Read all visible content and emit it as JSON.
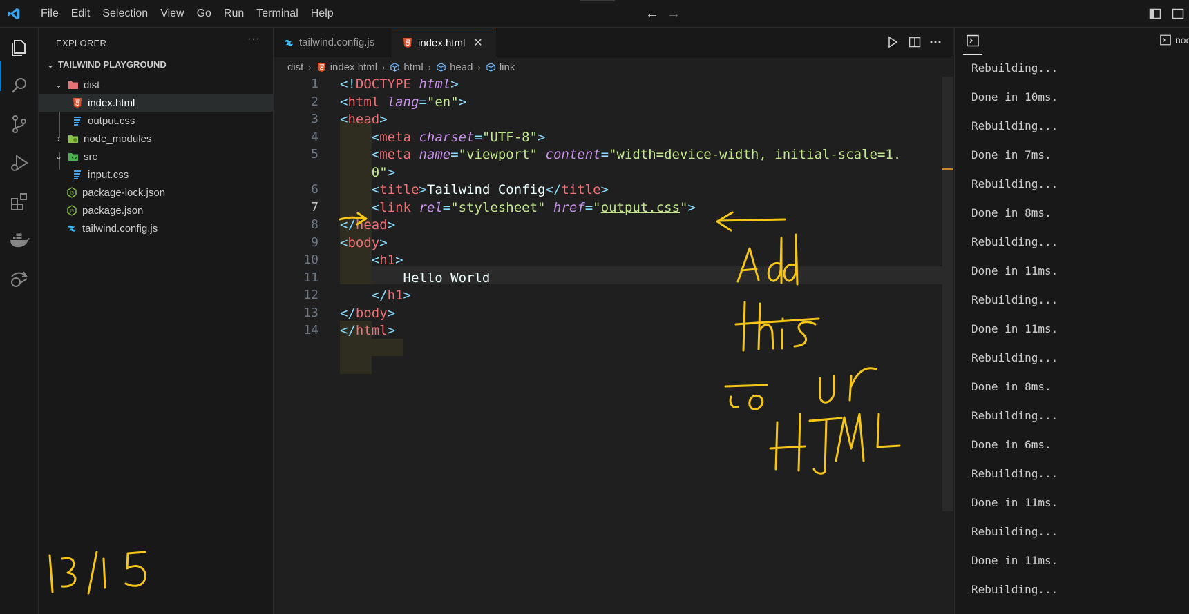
{
  "menu": [
    "File",
    "Edit",
    "Selection",
    "View",
    "Go",
    "Run",
    "Terminal",
    "Help"
  ],
  "sidebar": {
    "title": "EXPLORER",
    "more": "···",
    "project": "TAILWIND PLAYGROUND",
    "tree": [
      {
        "label": "dist",
        "type": "folder",
        "expanded": true,
        "icon": "dist-folder-icon"
      },
      {
        "label": "index.html",
        "type": "file",
        "icon": "html5-icon",
        "selected": true
      },
      {
        "label": "output.css",
        "type": "file",
        "icon": "css-icon"
      },
      {
        "label": "node_modules",
        "type": "folder",
        "expanded": false,
        "icon": "node-folder-icon"
      },
      {
        "label": "src",
        "type": "folder",
        "expanded": true,
        "icon": "src-folder-icon"
      },
      {
        "label": "input.css",
        "type": "file",
        "icon": "css-icon"
      },
      {
        "label": "package-lock.json",
        "type": "file",
        "icon": "nodejs-icon"
      },
      {
        "label": "package.json",
        "type": "file",
        "icon": "nodejs-icon"
      },
      {
        "label": "tailwind.config.js",
        "type": "file",
        "icon": "tailwind-icon"
      }
    ]
  },
  "tabs": [
    {
      "label": "tailwind.config.js",
      "active": false
    },
    {
      "label": "index.html",
      "active": true,
      "close": "✕"
    }
  ],
  "breadcrumb": [
    "dist",
    "index.html",
    "html",
    "head",
    "link"
  ],
  "code": {
    "current_line": 7,
    "lines": [
      {
        "n": "1",
        "tokens": [
          [
            "br",
            "<!"
          ],
          [
            "tag",
            "DOCTYPE"
          ],
          [
            "txt",
            " "
          ],
          [
            "attr",
            "html"
          ],
          [
            "br",
            ">"
          ]
        ]
      },
      {
        "n": "2",
        "tokens": [
          [
            "br",
            "<"
          ],
          [
            "tag",
            "html"
          ],
          [
            "txt",
            " "
          ],
          [
            "attr",
            "lang"
          ],
          [
            "br",
            "="
          ],
          [
            "str",
            "\"en\""
          ],
          [
            "br",
            ">"
          ]
        ]
      },
      {
        "n": "3",
        "tokens": [
          [
            "br",
            "<"
          ],
          [
            "tag",
            "head"
          ],
          [
            "br",
            ">"
          ]
        ]
      },
      {
        "n": "4",
        "tokens": [
          [
            "txt",
            "    "
          ],
          [
            "br",
            "<"
          ],
          [
            "tag",
            "meta"
          ],
          [
            "txt",
            " "
          ],
          [
            "attr",
            "charset"
          ],
          [
            "br",
            "="
          ],
          [
            "str",
            "\"UTF-8\""
          ],
          [
            "br",
            ">"
          ]
        ]
      },
      {
        "n": "5",
        "tokens": [
          [
            "txt",
            "    "
          ],
          [
            "br",
            "<"
          ],
          [
            "tag",
            "meta"
          ],
          [
            "txt",
            " "
          ],
          [
            "attr",
            "name"
          ],
          [
            "br",
            "="
          ],
          [
            "str",
            "\"viewport\""
          ],
          [
            "txt",
            " "
          ],
          [
            "attr",
            "content"
          ],
          [
            "br",
            "="
          ],
          [
            "str",
            "\"width=device-width, initial-scale=1."
          ]
        ]
      },
      {
        "n": "",
        "tokens": [
          [
            "txt",
            "    "
          ],
          [
            "str",
            "0\""
          ],
          [
            "br",
            ">"
          ]
        ]
      },
      {
        "n": "6",
        "tokens": [
          [
            "txt",
            "    "
          ],
          [
            "br",
            "<"
          ],
          [
            "tag",
            "title"
          ],
          [
            "br",
            ">"
          ],
          [
            "txt",
            "Tailwind Config"
          ],
          [
            "br",
            "</"
          ],
          [
            "tag",
            "title"
          ],
          [
            "br",
            ">"
          ]
        ]
      },
      {
        "n": "7",
        "tokens": [
          [
            "txt",
            "    "
          ],
          [
            "br",
            "<"
          ],
          [
            "tag",
            "link"
          ],
          [
            "txt",
            " "
          ],
          [
            "attr",
            "rel"
          ],
          [
            "br",
            "="
          ],
          [
            "str",
            "\"stylesheet\""
          ],
          [
            "txt",
            " "
          ],
          [
            "attr",
            "href"
          ],
          [
            "br",
            "="
          ],
          [
            "str",
            "\""
          ],
          [
            "str",
            "output.css"
          ],
          [
            "str",
            "\""
          ],
          [
            "br",
            ">"
          ]
        ]
      },
      {
        "n": "8",
        "tokens": [
          [
            "br",
            "</"
          ],
          [
            "tag",
            "head"
          ],
          [
            "br",
            ">"
          ]
        ]
      },
      {
        "n": "9",
        "tokens": [
          [
            "br",
            "<"
          ],
          [
            "tag",
            "body"
          ],
          [
            "br",
            ">"
          ]
        ]
      },
      {
        "n": "10",
        "tokens": [
          [
            "txt",
            "    "
          ],
          [
            "br",
            "<"
          ],
          [
            "tag",
            "h1"
          ],
          [
            "br",
            ">"
          ]
        ]
      },
      {
        "n": "11",
        "tokens": [
          [
            "txt",
            "        Hello World"
          ]
        ]
      },
      {
        "n": "12",
        "tokens": [
          [
            "txt",
            "    "
          ],
          [
            "br",
            "</"
          ],
          [
            "tag",
            "h1"
          ],
          [
            "br",
            ">"
          ]
        ]
      },
      {
        "n": "13",
        "tokens": [
          [
            "br",
            "</"
          ],
          [
            "tag",
            "body"
          ],
          [
            "br",
            ">"
          ]
        ]
      },
      {
        "n": "14",
        "tokens": [
          [
            "br",
            "</"
          ],
          [
            "tag",
            "html"
          ],
          [
            "br",
            ">"
          ]
        ]
      }
    ]
  },
  "terminal": {
    "tab2_label": "nod",
    "lines": [
      "Rebuilding...",
      "Done in 10ms.",
      "Rebuilding...",
      "Done in 7ms.",
      "Rebuilding...",
      "Done in 8ms.",
      "Rebuilding...",
      "Done in 11ms.",
      "Rebuilding...",
      "Done in 11ms.",
      "Rebuilding...",
      "Done in 8ms.",
      "Rebuilding...",
      "Done in 6ms.",
      "Rebuilding...",
      "Done in 11ms.",
      "Rebuilding...",
      "Done in 11ms.",
      "Rebuilding..."
    ]
  },
  "annotations": {
    "note": "Add this to ur HTML",
    "counter": "13/15",
    "color": "#f5c518"
  },
  "colors": {
    "accent": "#0078d4",
    "html_icon": "#e44d26",
    "css_icon": "#42a5f5",
    "node_icon": "#8bc34a",
    "tailwind_icon": "#38bdf8"
  }
}
